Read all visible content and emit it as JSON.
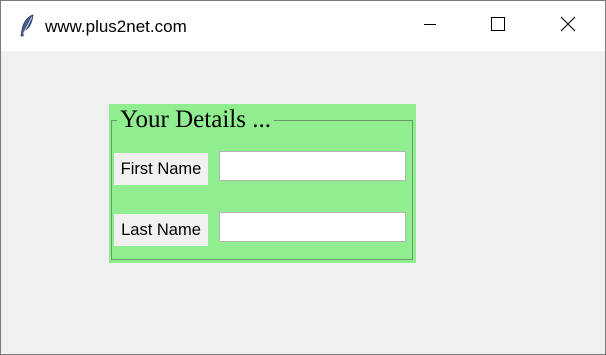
{
  "window": {
    "title": "www.plus2net.com",
    "icon": "feather-icon",
    "controls": {
      "minimize": "minimize-icon",
      "maximize": "maximize-icon",
      "close": "close-icon"
    }
  },
  "form": {
    "frame_title": "Your Details ...",
    "frame_background": "#90ee90",
    "fields": [
      {
        "label": "First Name",
        "value": ""
      },
      {
        "label": "Last Name",
        "value": ""
      }
    ]
  }
}
